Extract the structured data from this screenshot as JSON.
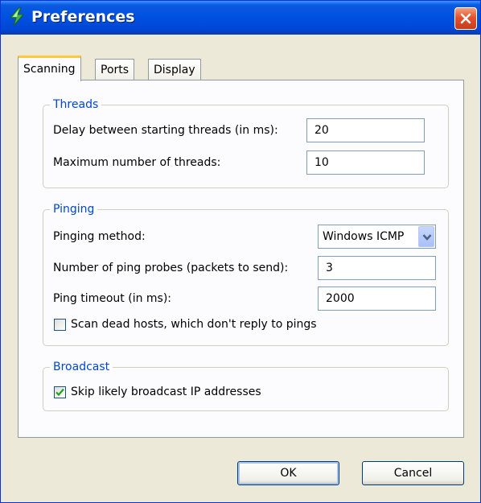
{
  "window": {
    "title": "Preferences",
    "app_icon": "lightning-bolt-icon",
    "close_icon": "close-icon"
  },
  "tabs": [
    {
      "label": "Scanning",
      "active": true
    },
    {
      "label": "Ports",
      "active": false
    },
    {
      "label": "Display",
      "active": false
    }
  ],
  "threads": {
    "legend": "Threads",
    "delay_label": "Delay between starting threads (in ms):",
    "delay_value": "20",
    "max_label": "Maximum number of threads:",
    "max_value": "10"
  },
  "pinging": {
    "legend": "Pinging",
    "method_label": "Pinging method:",
    "method_value": "Windows ICMP",
    "probes_label": "Number of ping probes (packets to send):",
    "probes_value": "3",
    "timeout_label": "Ping timeout (in ms):",
    "timeout_value": "2000",
    "dead_hosts_label": "Scan dead hosts, which don't reply to pings",
    "dead_hosts_checked": false
  },
  "broadcast": {
    "legend": "Broadcast",
    "skip_label": "Skip likely broadcast IP addresses",
    "skip_checked": true
  },
  "buttons": {
    "ok": "OK",
    "cancel": "Cancel"
  },
  "colors": {
    "titlebar": "#0050e0",
    "legend_text": "#0046d5",
    "close_button": "#e5522c",
    "active_tab_highlight": "#ffc83c",
    "checkmark": "#21a121"
  }
}
